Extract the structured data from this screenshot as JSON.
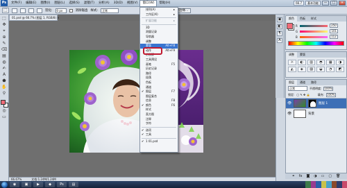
{
  "app": {
    "logo": "Ps"
  },
  "menubar": {
    "items": [
      "文件(F)",
      "编辑(E)",
      "图像(I)",
      "图层(L)",
      "选择(S)",
      "滤镜(T)",
      "分析(A)",
      "3D(D)",
      "视图(V)",
      "窗口(W)",
      "帮助(H)"
    ],
    "active_index": 9,
    "right": {
      "zoom": "66.7",
      "mode": "基本功能"
    },
    "window_buttons": [
      "—",
      "□",
      "×"
    ]
  },
  "optionsbar": {
    "tool_icon": "⬚",
    "feather_label": "羽化:",
    "feather_value": "0 px",
    "antialias_label": "消除锯齿",
    "style_label": "样式:",
    "style_value": "正常",
    "refine_label": "调整边缘..."
  },
  "document": {
    "tab": "01.psd @ 66.7% (图层 1, RGB/8) ×",
    "zoom": "66.67%",
    "doc_size": "文档:1.24M/1.24M"
  },
  "tools": [
    "⬚",
    "✥",
    "⌖",
    "⊕",
    "✎",
    "⌫",
    "▤",
    "◍",
    "✍",
    "A",
    "⬟",
    "✋",
    "⚲"
  ],
  "colors": {
    "foreground": "#f06b78",
    "background": "#ffffff",
    "accent": "#3874d0",
    "highlight_ring": "#c0182f"
  },
  "dropdown": {
    "items": [
      {
        "label": "排列(A)",
        "shortcut": "▸"
      },
      {
        "label": "工作区(K)",
        "shortcut": "▸"
      },
      {
        "sep": true
      },
      {
        "label": "扩展功能",
        "shortcut": "▸",
        "grey": true
      },
      {
        "sep": true
      },
      {
        "label": "3D"
      },
      {
        "label": "测量记录"
      },
      {
        "label": "导航器"
      },
      {
        "label": "调整"
      },
      {
        "label": "蒙版",
        "shortcut": "Alt+F8",
        "highlight": true
      },
      {
        "label": "动作",
        "shortcut": "Alt+F9"
      },
      {
        "label": "仿制源"
      },
      {
        "label": "工具预设"
      },
      {
        "label": "画笔",
        "shortcut": "F5"
      },
      {
        "label": "历史记录"
      },
      {
        "label": "路径"
      },
      {
        "label": "段落"
      },
      {
        "label": "色板"
      },
      {
        "label": "通道"
      },
      {
        "label": "图层",
        "shortcut": "F7",
        "checked": true
      },
      {
        "label": "图层复合"
      },
      {
        "label": "信息",
        "shortcut": "F8"
      },
      {
        "label": "颜色",
        "shortcut": "F6",
        "checked": true
      },
      {
        "label": "样式"
      },
      {
        "label": "直方图"
      },
      {
        "label": "注释"
      },
      {
        "label": "字符"
      },
      {
        "sep": true
      },
      {
        "label": "选项",
        "checked": true
      },
      {
        "label": "工具",
        "checked": true
      },
      {
        "sep": true
      },
      {
        "label": "1 01.psd",
        "checked": true
      }
    ]
  },
  "panels": {
    "collapsed": [
      "▣",
      "◧",
      "¶",
      "A"
    ],
    "color": {
      "tabs": [
        "颜色",
        "色板",
        "样式"
      ],
      "rows": [
        {
          "label": "R",
          "value": "250"
        },
        {
          "label": "G",
          "value": "101"
        },
        {
          "label": "B",
          "value": "112"
        }
      ]
    },
    "adjust": {
      "tabs": [
        "调整",
        "蒙版"
      ],
      "icons": [
        "☼",
        "◐",
        "▥",
        "◓",
        "▦",
        "◑",
        "◭",
        "◈",
        "▨",
        "◒",
        "◔",
        "◩"
      ]
    },
    "layers": {
      "tabs": [
        "图层",
        "通道",
        "路径"
      ],
      "blend": "正常",
      "opacity_label": "不透明度:",
      "opacity": "100%",
      "lock_label": "锁定:",
      "fill_label": "填充:",
      "fill": "100%",
      "rows": [
        {
          "name": "图层 1",
          "selected": true
        },
        {
          "name": "背景",
          "selected": false
        }
      ],
      "footer": [
        "⚭",
        "fx",
        "◙",
        "◑",
        "▭",
        "▢",
        "🗑"
      ]
    }
  },
  "taskbar": {
    "buttons": [
      "◉",
      "▣",
      "▶",
      "◆",
      "Ps",
      "▤"
    ]
  }
}
